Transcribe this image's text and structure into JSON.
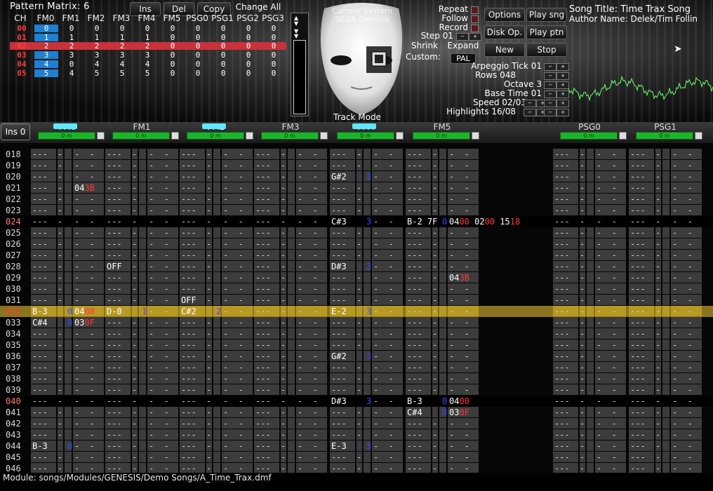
{
  "pattern_matrix": {
    "title": "Pattern Matrix: 6",
    "buttons": [
      "Ins",
      "Del",
      "Copy",
      "Change All"
    ],
    "headers": [
      "CH",
      "FM0",
      "FM1",
      "FM2",
      "FM3",
      "FM4",
      "FM5",
      "PSG0",
      "PSG1",
      "PSG2",
      "PSG3"
    ],
    "rows": [
      {
        "ch": "00",
        "vals": [
          "0",
          "0",
          "0",
          "0",
          "0",
          "0",
          "0",
          "0",
          "0",
          "0"
        ]
      },
      {
        "ch": "01",
        "vals": [
          "1",
          "1",
          "1",
          "1",
          "1",
          "0",
          "0",
          "0",
          "0",
          "0"
        ]
      },
      {
        "ch": "02",
        "vals": [
          "2",
          "2",
          "2",
          "2",
          "2",
          "0",
          "0",
          "0",
          "0",
          "0"
        ]
      },
      {
        "ch": "03",
        "vals": [
          "3",
          "3",
          "3",
          "3",
          "3",
          "0",
          "0",
          "0",
          "0",
          "0"
        ]
      },
      {
        "ch": "04",
        "vals": [
          "4",
          "0",
          "4",
          "4",
          "4",
          "0",
          "0",
          "0",
          "0",
          "0"
        ]
      },
      {
        "ch": "05",
        "vals": [
          "5",
          "4",
          "5",
          "5",
          "5",
          "0",
          "0",
          "0",
          "0",
          "0"
        ]
      }
    ]
  },
  "mask_text": {
    "line1": "Current System",
    "line2": "SEGA Genesis",
    "mode": "Track Mode"
  },
  "controls": {
    "repeat": "Repeat",
    "follow": "Follow",
    "record": "Record",
    "step": "Step 01",
    "shrink": "Shrink",
    "expand": "Expand",
    "custom": "Custom:",
    "pal": "PAL",
    "options": "Options",
    "play_song": "Play sng",
    "disk_op": "Disk Op.",
    "play_pattern": "Play ptn",
    "new": "New",
    "stop": "Stop"
  },
  "song": {
    "title": "Song Title: Time Trax Song",
    "author": "Author Name: Delek/Tim Follin"
  },
  "params": [
    "Arpeggio Tick 01",
    "Rows 048",
    "Octave 3",
    "Base Time 01",
    "Speed 02/03",
    "Highlights 16/08"
  ],
  "instrument_button": "Ins 0",
  "channels": [
    "FM0",
    "FM1",
    "FM2",
    "FM3",
    "FM4",
    "FM5",
    "PSG0",
    "PSG1"
  ],
  "meter_label": "0 m",
  "rows": [
    {
      "n": "018"
    },
    {
      "n": "019"
    },
    {
      "n": "020",
      "c": [
        null,
        null,
        null,
        null,
        [
          "G#2",
          "3",
          ""
        ],
        null,
        null,
        null
      ]
    },
    {
      "n": "021",
      "c": [
        [
          "",
          "",
          "043B"
        ],
        null,
        null,
        null,
        null,
        null,
        null,
        null
      ]
    },
    {
      "n": "022"
    },
    {
      "n": "023"
    },
    {
      "n": "024",
      "hl": true,
      "c": [
        null,
        null,
        null,
        null,
        [
          "C#3",
          "3",
          ""
        ],
        [
          "B-2 7F",
          "0",
          "0400 0200 1518"
        ],
        null,
        null
      ]
    },
    {
      "n": "025"
    },
    {
      "n": "026"
    },
    {
      "n": "027"
    },
    {
      "n": "028",
      "c": [
        null,
        [
          "OFF",
          "",
          ""
        ],
        null,
        null,
        [
          "D#3",
          "3",
          ""
        ],
        null,
        null,
        null
      ]
    },
    {
      "n": "029",
      "c": [
        null,
        null,
        null,
        null,
        null,
        [
          "",
          "",
          "043B"
        ],
        null,
        null
      ]
    },
    {
      "n": "030"
    },
    {
      "n": "031",
      "c": [
        null,
        null,
        [
          "OFF",
          "",
          ""
        ],
        null,
        null,
        null,
        null,
        null
      ]
    },
    {
      "n": "032",
      "cur": true,
      "c": [
        [
          "B-3",
          "0",
          "0400"
        ],
        [
          "D-0",
          "1",
          ""
        ],
        [
          "C#2",
          "2",
          ""
        ],
        null,
        [
          "E-2",
          "3",
          ""
        ],
        null,
        null,
        null
      ]
    },
    {
      "n": "033",
      "c": [
        [
          "C#4",
          "0",
          "030F"
        ],
        null,
        null,
        null,
        null,
        null,
        null,
        null
      ]
    },
    {
      "n": "034"
    },
    {
      "n": "035"
    },
    {
      "n": "036",
      "c": [
        null,
        null,
        null,
        null,
        [
          "G#2",
          "3",
          ""
        ],
        null,
        null,
        null
      ]
    },
    {
      "n": "037"
    },
    {
      "n": "038"
    },
    {
      "n": "039"
    },
    {
      "n": "040",
      "hl": true,
      "c": [
        null,
        null,
        null,
        null,
        [
          "D#3",
          "3",
          ""
        ],
        [
          "B-3",
          "0",
          "0400"
        ],
        null,
        null
      ]
    },
    {
      "n": "041",
      "c": [
        null,
        null,
        null,
        null,
        null,
        [
          "C#4",
          "0",
          "030F"
        ],
        null,
        null
      ]
    },
    {
      "n": "042"
    },
    {
      "n": "043"
    },
    {
      "n": "044",
      "c": [
        [
          "B-3",
          "0",
          ""
        ],
        null,
        null,
        null,
        [
          "E-3",
          "3",
          ""
        ],
        null,
        null,
        null
      ]
    },
    {
      "n": "045"
    },
    {
      "n": "046"
    }
  ],
  "module_path": "Module: songs/Modules/GENESIS/Demo Songs/A_Time_Trax.dmf"
}
